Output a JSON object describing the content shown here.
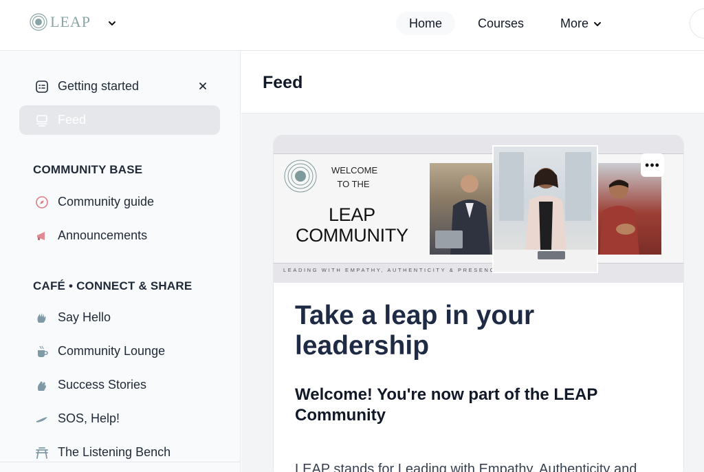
{
  "topbar": {
    "logo_text": "LEAP",
    "nav": {
      "home": "Home",
      "courses": "Courses",
      "more": "More"
    }
  },
  "sidebar": {
    "getting_started": "Getting started",
    "feed": "Feed",
    "sections": [
      {
        "heading": "COMMUNITY BASE",
        "items": [
          "Community guide",
          "Announcements"
        ]
      },
      {
        "heading": "CAFÉ • CONNECT & SHARE",
        "items": [
          "Say Hello",
          "Community Lounge",
          "Success Stories",
          "SOS, Help!",
          "The Listening Bench"
        ]
      }
    ],
    "icons": {
      "getting_started": "checklist-icon",
      "feed": "feed-icon",
      "community_guide": "compass-icon",
      "announcements": "megaphone-icon",
      "say_hello": "waving-hand-icon",
      "community_lounge": "coffee-icon",
      "success_stories": "clapping-hands-icon",
      "sos_help": "helping-hand-icon",
      "listening_bench": "bench-icon"
    }
  },
  "main": {
    "title": "Feed",
    "post": {
      "banner": {
        "welcome": "WELCOME TO THE",
        "title_line1": "LEAP",
        "title_line2": "COMMUNITY",
        "tagline": "LEADING WITH EMPATHY, AUTHENTICITY & PRESENCE"
      },
      "more_label": "•••",
      "title": "Take a leap in your leadership",
      "subtitle": "Welcome! You're now part of the LEAP Community",
      "body": "LEAP stands for Leading with Empathy, Authenticity and"
    }
  },
  "colors": {
    "accent": "#8aa5a5",
    "active_bg": "#e5e7eb",
    "title": "#1f2a44"
  }
}
